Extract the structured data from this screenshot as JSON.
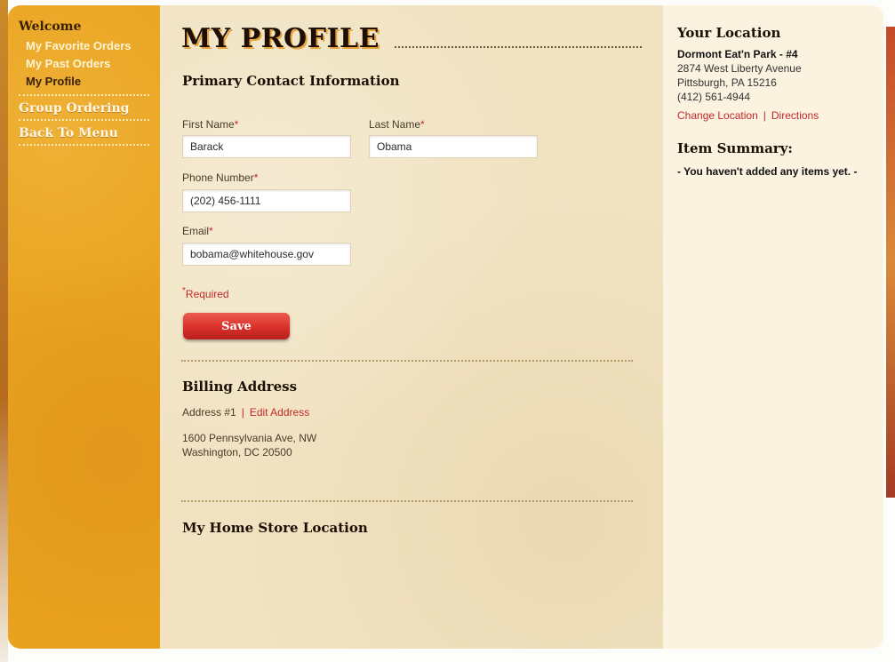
{
  "sidebar": {
    "welcome": "Welcome",
    "sub_items": [
      {
        "label": "My Favorite Orders",
        "active": false
      },
      {
        "label": "My Past Orders",
        "active": false
      },
      {
        "label": "My Profile",
        "active": true
      }
    ],
    "group_ordering": "Group Ordering",
    "back_to_menu": "Back To Menu"
  },
  "main": {
    "title": "MY PROFILE",
    "contact_heading": "Primary Contact Information",
    "first_name_label": "First Name",
    "first_name_value": "Barack",
    "last_name_label": "Last Name",
    "last_name_value": "Obama",
    "phone_label": "Phone Number",
    "phone_value": "(202) 456-1111",
    "email_label": "Email",
    "email_value": "bobama@whitehouse.gov",
    "required_mark": "*",
    "required_note": "Required",
    "save_label": "Save",
    "billing_heading": "Billing Address",
    "address_label": "Address #1",
    "edit_address": "Edit Address",
    "address_line1": "1600 Pennsylvania Ave, NW",
    "address_line2": "Washington, DC 20500",
    "home_store_heading": "My Home Store Location"
  },
  "location": {
    "heading": "Your Location",
    "store_name": "Dormont Eat'n Park - #4",
    "street": "2874 West Liberty Avenue",
    "city": "Pittsburgh, PA 15216",
    "phone": "(412) 561-4944",
    "change_location": "Change Location",
    "separator": "|",
    "directions": "Directions"
  },
  "summary": {
    "heading": "Item Summary:",
    "empty_text": "- You haven't added any items yet. -"
  },
  "colors": {
    "sidebar_orange": "#e9a21f",
    "accent_red": "#c4282a",
    "paper": "#f1e3c2"
  }
}
